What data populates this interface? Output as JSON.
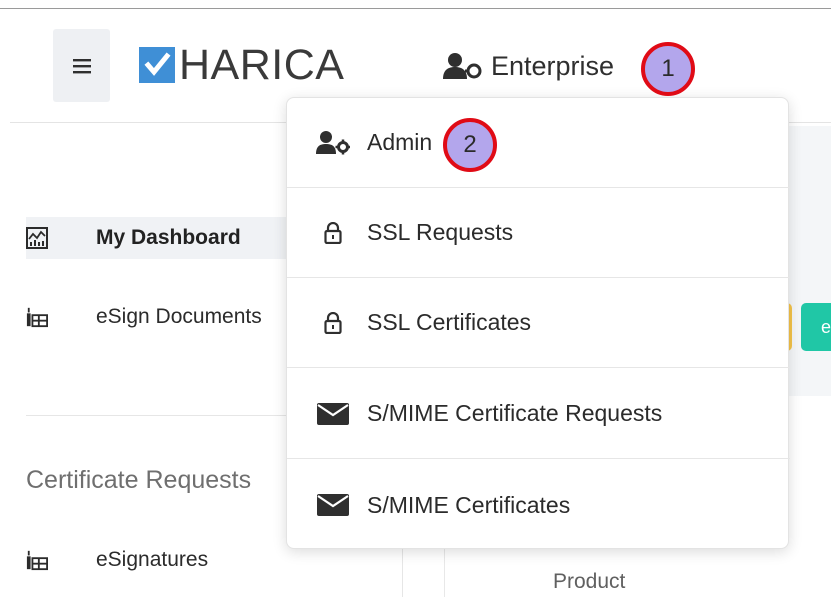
{
  "header": {
    "logo_text": "HARICA",
    "menu_icon": "hamburger-menu-icon",
    "enterprise_label": "Enterprise",
    "enterprise_icon": "user-key-icon"
  },
  "callouts": {
    "one": "1",
    "two": "2"
  },
  "dropdown": {
    "items": [
      {
        "label": "Admin",
        "icon": "user-gear-icon"
      },
      {
        "label": "SSL Requests",
        "icon": "lock-icon"
      },
      {
        "label": "SSL Certificates",
        "icon": "lock-icon"
      },
      {
        "label": "S/MIME Certificate Requests",
        "icon": "envelope-icon"
      },
      {
        "label": "S/MIME Certificates",
        "icon": "envelope-icon"
      }
    ]
  },
  "sidebar": {
    "items": [
      {
        "label": "My Dashboard",
        "icon": "dashboard-chart-icon"
      },
      {
        "label": "eSign Documents",
        "icon": "esign-icon"
      }
    ],
    "section_heading": "Certificate Requests",
    "section_items": [
      {
        "label": "eSignatures",
        "icon": "esign-icon"
      }
    ]
  },
  "main": {
    "product_label": "Product",
    "teal_button_label": "e"
  },
  "colors": {
    "logo_blue": "#3f8fd6",
    "callout_fill": "#b3a6ec",
    "callout_border": "#e00b16",
    "teal": "#20c7a6",
    "yellow": "#f5c44a"
  }
}
